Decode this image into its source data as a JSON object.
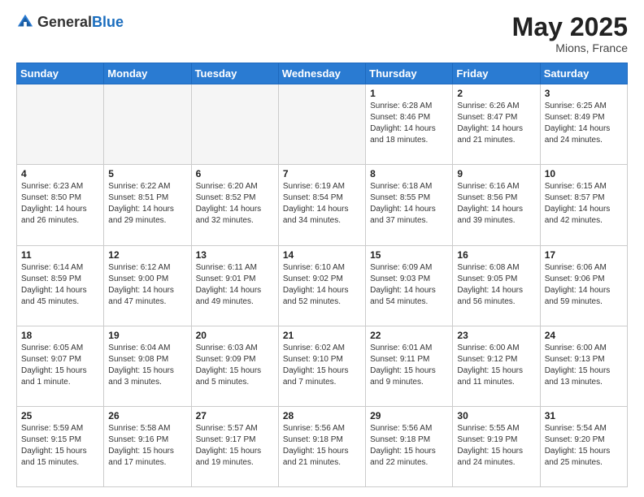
{
  "header": {
    "logo_general": "General",
    "logo_blue": "Blue",
    "month_year": "May 2025",
    "location": "Mions, France"
  },
  "weekdays": [
    "Sunday",
    "Monday",
    "Tuesday",
    "Wednesday",
    "Thursday",
    "Friday",
    "Saturday"
  ],
  "weeks": [
    [
      {
        "day": "",
        "info": ""
      },
      {
        "day": "",
        "info": ""
      },
      {
        "day": "",
        "info": ""
      },
      {
        "day": "",
        "info": ""
      },
      {
        "day": "1",
        "info": "Sunrise: 6:28 AM\nSunset: 8:46 PM\nDaylight: 14 hours\nand 18 minutes."
      },
      {
        "day": "2",
        "info": "Sunrise: 6:26 AM\nSunset: 8:47 PM\nDaylight: 14 hours\nand 21 minutes."
      },
      {
        "day": "3",
        "info": "Sunrise: 6:25 AM\nSunset: 8:49 PM\nDaylight: 14 hours\nand 24 minutes."
      }
    ],
    [
      {
        "day": "4",
        "info": "Sunrise: 6:23 AM\nSunset: 8:50 PM\nDaylight: 14 hours\nand 26 minutes."
      },
      {
        "day": "5",
        "info": "Sunrise: 6:22 AM\nSunset: 8:51 PM\nDaylight: 14 hours\nand 29 minutes."
      },
      {
        "day": "6",
        "info": "Sunrise: 6:20 AM\nSunset: 8:52 PM\nDaylight: 14 hours\nand 32 minutes."
      },
      {
        "day": "7",
        "info": "Sunrise: 6:19 AM\nSunset: 8:54 PM\nDaylight: 14 hours\nand 34 minutes."
      },
      {
        "day": "8",
        "info": "Sunrise: 6:18 AM\nSunset: 8:55 PM\nDaylight: 14 hours\nand 37 minutes."
      },
      {
        "day": "9",
        "info": "Sunrise: 6:16 AM\nSunset: 8:56 PM\nDaylight: 14 hours\nand 39 minutes."
      },
      {
        "day": "10",
        "info": "Sunrise: 6:15 AM\nSunset: 8:57 PM\nDaylight: 14 hours\nand 42 minutes."
      }
    ],
    [
      {
        "day": "11",
        "info": "Sunrise: 6:14 AM\nSunset: 8:59 PM\nDaylight: 14 hours\nand 45 minutes."
      },
      {
        "day": "12",
        "info": "Sunrise: 6:12 AM\nSunset: 9:00 PM\nDaylight: 14 hours\nand 47 minutes."
      },
      {
        "day": "13",
        "info": "Sunrise: 6:11 AM\nSunset: 9:01 PM\nDaylight: 14 hours\nand 49 minutes."
      },
      {
        "day": "14",
        "info": "Sunrise: 6:10 AM\nSunset: 9:02 PM\nDaylight: 14 hours\nand 52 minutes."
      },
      {
        "day": "15",
        "info": "Sunrise: 6:09 AM\nSunset: 9:03 PM\nDaylight: 14 hours\nand 54 minutes."
      },
      {
        "day": "16",
        "info": "Sunrise: 6:08 AM\nSunset: 9:05 PM\nDaylight: 14 hours\nand 56 minutes."
      },
      {
        "day": "17",
        "info": "Sunrise: 6:06 AM\nSunset: 9:06 PM\nDaylight: 14 hours\nand 59 minutes."
      }
    ],
    [
      {
        "day": "18",
        "info": "Sunrise: 6:05 AM\nSunset: 9:07 PM\nDaylight: 15 hours\nand 1 minute."
      },
      {
        "day": "19",
        "info": "Sunrise: 6:04 AM\nSunset: 9:08 PM\nDaylight: 15 hours\nand 3 minutes."
      },
      {
        "day": "20",
        "info": "Sunrise: 6:03 AM\nSunset: 9:09 PM\nDaylight: 15 hours\nand 5 minutes."
      },
      {
        "day": "21",
        "info": "Sunrise: 6:02 AM\nSunset: 9:10 PM\nDaylight: 15 hours\nand 7 minutes."
      },
      {
        "day": "22",
        "info": "Sunrise: 6:01 AM\nSunset: 9:11 PM\nDaylight: 15 hours\nand 9 minutes."
      },
      {
        "day": "23",
        "info": "Sunrise: 6:00 AM\nSunset: 9:12 PM\nDaylight: 15 hours\nand 11 minutes."
      },
      {
        "day": "24",
        "info": "Sunrise: 6:00 AM\nSunset: 9:13 PM\nDaylight: 15 hours\nand 13 minutes."
      }
    ],
    [
      {
        "day": "25",
        "info": "Sunrise: 5:59 AM\nSunset: 9:15 PM\nDaylight: 15 hours\nand 15 minutes."
      },
      {
        "day": "26",
        "info": "Sunrise: 5:58 AM\nSunset: 9:16 PM\nDaylight: 15 hours\nand 17 minutes."
      },
      {
        "day": "27",
        "info": "Sunrise: 5:57 AM\nSunset: 9:17 PM\nDaylight: 15 hours\nand 19 minutes."
      },
      {
        "day": "28",
        "info": "Sunrise: 5:56 AM\nSunset: 9:18 PM\nDaylight: 15 hours\nand 21 minutes."
      },
      {
        "day": "29",
        "info": "Sunrise: 5:56 AM\nSunset: 9:18 PM\nDaylight: 15 hours\nand 22 minutes."
      },
      {
        "day": "30",
        "info": "Sunrise: 5:55 AM\nSunset: 9:19 PM\nDaylight: 15 hours\nand 24 minutes."
      },
      {
        "day": "31",
        "info": "Sunrise: 5:54 AM\nSunset: 9:20 PM\nDaylight: 15 hours\nand 25 minutes."
      }
    ]
  ]
}
